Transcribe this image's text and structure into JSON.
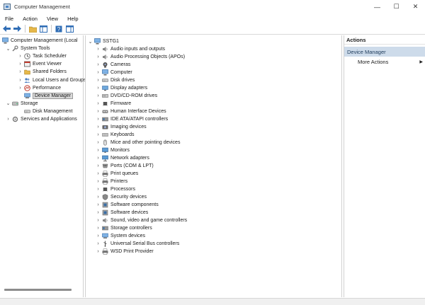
{
  "window": {
    "title": "Computer Management",
    "minimize": "—",
    "maximize": "☐",
    "close": "✕"
  },
  "menu": [
    "File",
    "Action",
    "View",
    "Help"
  ],
  "left_tree": [
    {
      "label": "Computer Management (Local",
      "indent": 0,
      "chevron": "",
      "icon": "computer"
    },
    {
      "label": "System Tools",
      "indent": 1,
      "chevron": "v",
      "icon": "tools"
    },
    {
      "label": "Task Scheduler",
      "indent": 2,
      "chevron": ">",
      "icon": "clock"
    },
    {
      "label": "Event Viewer",
      "indent": 2,
      "chevron": ">",
      "icon": "event"
    },
    {
      "label": "Shared Folders",
      "indent": 2,
      "chevron": ">",
      "icon": "folder"
    },
    {
      "label": "Local Users and Groups",
      "indent": 2,
      "chevron": ">",
      "icon": "users"
    },
    {
      "label": "Performance",
      "indent": 2,
      "chevron": ">",
      "icon": "performance"
    },
    {
      "label": "Device Manager",
      "indent": 2,
      "chevron": "",
      "icon": "device-manager",
      "selected": true
    },
    {
      "label": "Storage",
      "indent": 1,
      "chevron": "v",
      "icon": "storage"
    },
    {
      "label": "Disk Management",
      "indent": 2,
      "chevron": "",
      "icon": "disk"
    },
    {
      "label": "Services and Applications",
      "indent": 1,
      "chevron": ">",
      "icon": "services"
    }
  ],
  "device_tree": {
    "root": "SSTG1",
    "items": [
      {
        "label": "Audio inputs and outputs",
        "icon": "audio"
      },
      {
        "label": "Audio Processing Objects (APOs)",
        "icon": "audio"
      },
      {
        "label": "Cameras",
        "icon": "camera"
      },
      {
        "label": "Computer",
        "icon": "computer"
      },
      {
        "label": "Disk drives",
        "icon": "disk"
      },
      {
        "label": "Display adapters",
        "icon": "display"
      },
      {
        "label": "DVD/CD-ROM drives",
        "icon": "dvd"
      },
      {
        "label": "Firmware",
        "icon": "chip"
      },
      {
        "label": "Human Interface Devices",
        "icon": "hid"
      },
      {
        "label": "IDE ATA/ATAPI controllers",
        "icon": "controller"
      },
      {
        "label": "Imaging devices",
        "icon": "imaging"
      },
      {
        "label": "Keyboards",
        "icon": "keyboard"
      },
      {
        "label": "Mice and other pointing devices",
        "icon": "mouse"
      },
      {
        "label": "Monitors",
        "icon": "monitor"
      },
      {
        "label": "Network adapters",
        "icon": "network"
      },
      {
        "label": "Ports (COM & LPT)",
        "icon": "port"
      },
      {
        "label": "Print queues",
        "icon": "printer"
      },
      {
        "label": "Printers",
        "icon": "printer"
      },
      {
        "label": "Processors",
        "icon": "chip"
      },
      {
        "label": "Security devices",
        "icon": "security"
      },
      {
        "label": "Software components",
        "icon": "software"
      },
      {
        "label": "Software devices",
        "icon": "software"
      },
      {
        "label": "Sound, video and game controllers",
        "icon": "audio"
      },
      {
        "label": "Storage controllers",
        "icon": "controller"
      },
      {
        "label": "System devices",
        "icon": "system"
      },
      {
        "label": "Universal Serial Bus controllers",
        "icon": "usb"
      },
      {
        "label": "WSD Print Provider",
        "icon": "printer"
      }
    ]
  },
  "actions": {
    "header": "Actions",
    "section": "Device Manager",
    "item": "More Actions",
    "item_arrow": "▶"
  },
  "colors": {
    "selection_bg": "#d9d9d9",
    "actions_section_bg": "#cddbea",
    "accent": "#2f6db5"
  }
}
